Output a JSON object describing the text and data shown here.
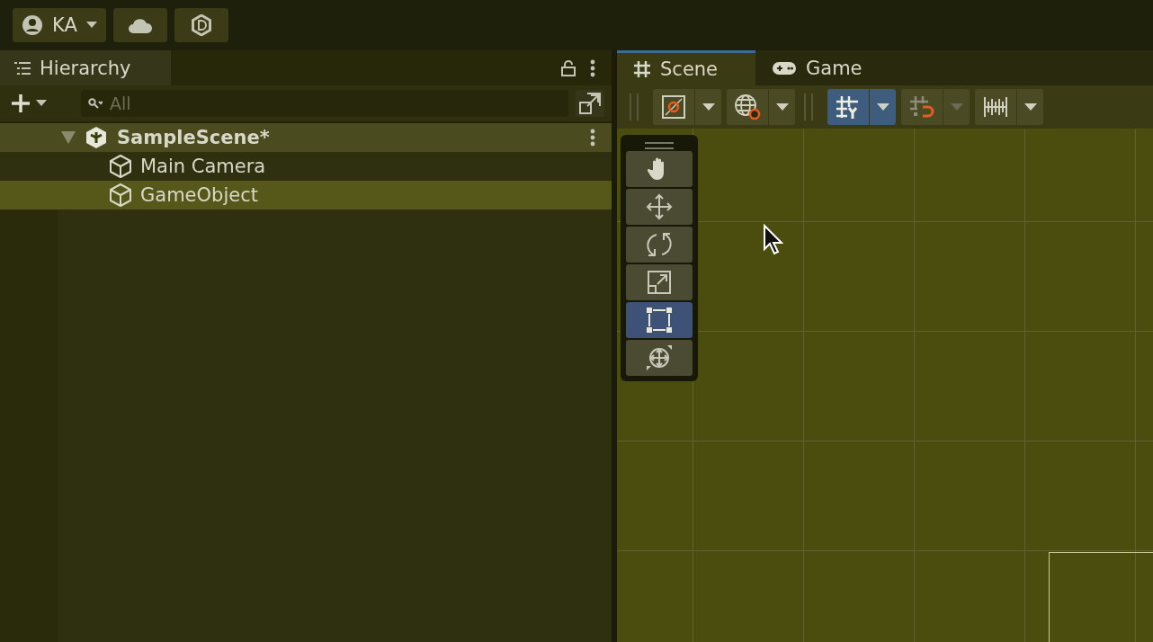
{
  "account": {
    "label": "KA"
  },
  "hierarchy": {
    "title": "Hierarchy",
    "search": {
      "placeholder": "All"
    },
    "items": [
      {
        "label": "SampleScene*",
        "kind": "scene",
        "expanded": true,
        "selected": false,
        "children": [
          {
            "label": "Main Camera",
            "kind": "object",
            "selected": false
          },
          {
            "label": "GameObject",
            "kind": "object",
            "selected": true
          }
        ]
      }
    ]
  },
  "tabs": [
    {
      "label": "Scene",
      "kind": "scene",
      "selected": true
    },
    {
      "label": "Game",
      "kind": "game",
      "selected": false
    }
  ],
  "scene_toolbar": [
    {
      "kind": "draw-mode",
      "on": false
    },
    {
      "kind": "gizmo-globe",
      "on": false
    },
    {
      "kind": "grid",
      "on": true
    },
    {
      "kind": "snap",
      "on": false
    },
    {
      "kind": "increment",
      "on": false
    }
  ],
  "tools": [
    {
      "kind": "hand",
      "selected": false
    },
    {
      "kind": "move",
      "selected": false
    },
    {
      "kind": "rotate",
      "selected": false
    },
    {
      "kind": "scale",
      "selected": false
    },
    {
      "kind": "rect",
      "selected": true
    },
    {
      "kind": "transform",
      "selected": false
    }
  ]
}
